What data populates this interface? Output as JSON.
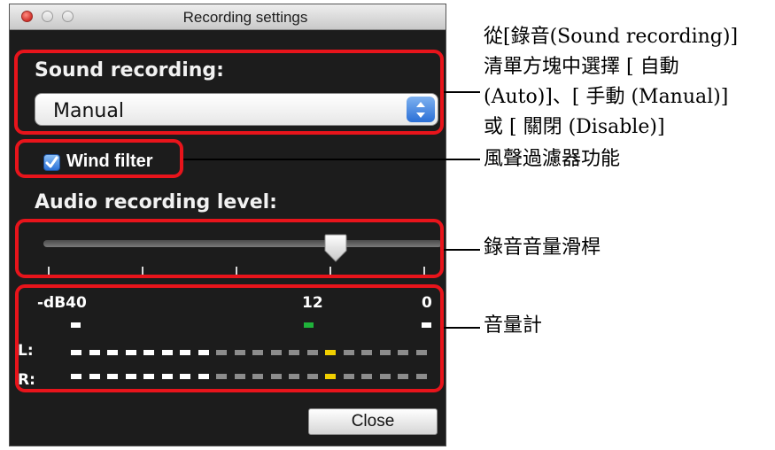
{
  "window": {
    "title": "Recording settings"
  },
  "sound_recording": {
    "label": "Sound recording:",
    "selected": "Manual"
  },
  "wind_filter": {
    "label": "Wind filter",
    "checked": true
  },
  "audio_level": {
    "label": "Audio recording level:",
    "value_fraction": 0.7,
    "tick_count": 5
  },
  "meter": {
    "label_left": "-dB40",
    "label_mid": "12",
    "label_right": "0",
    "channels": [
      "L:",
      "R:"
    ],
    "segment_count": 20,
    "active_segments": 8,
    "highlight_segment": 14,
    "colors": {
      "active": "#ffffff",
      "inactive": "#8c8c8c",
      "highlight": "#f0cf00",
      "mid_peak": "#1fb23a"
    }
  },
  "close_button": {
    "label": "Close"
  },
  "annotations": {
    "sound_lines": [
      "從[錄音(Sound recording)]",
      "清單方塊中選擇 [ 自動",
      "(Auto)]、[ 手動 (Manual)]",
      "或 [ 關閉 (Disable)]"
    ],
    "wind": "風聲過濾器功能",
    "slider": "錄音音量滑桿",
    "meter": "音量計"
  },
  "colors": {
    "highlight_border": "#e8141b",
    "window_bg": "#1c1c1c",
    "accent_blue": "#2a6fd6"
  }
}
